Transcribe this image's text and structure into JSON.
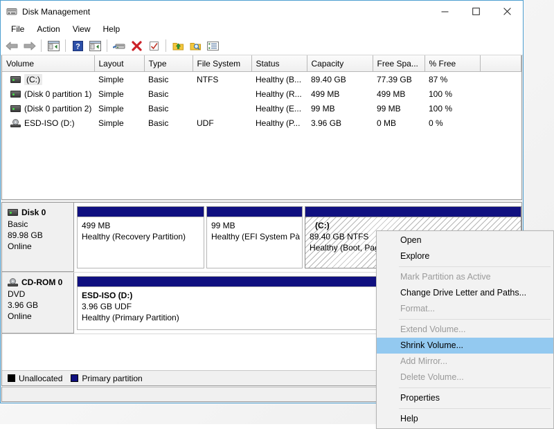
{
  "window": {
    "title": "Disk Management",
    "app_icon": "disk-management-icon",
    "caption": {
      "minimize": "minimize-icon",
      "maximize": "maximize-icon",
      "close": "close-icon"
    }
  },
  "menubar": {
    "items": [
      {
        "label": "File"
      },
      {
        "label": "Action"
      },
      {
        "label": "View"
      },
      {
        "label": "Help"
      }
    ]
  },
  "toolbar": {
    "buttons": [
      {
        "name": "back-arrow-icon",
        "title": "Back"
      },
      {
        "name": "forward-arrow-icon",
        "title": "Forward"
      },
      {
        "name": "up-one-level-icon",
        "title": "Up one level"
      },
      {
        "name": "help-icon",
        "title": "Help"
      },
      {
        "name": "show-console-tree-icon",
        "title": "Show/Hide Console Tree"
      },
      {
        "name": "properties-disk-icon",
        "title": "Properties"
      },
      {
        "name": "delete-icon",
        "title": "Delete"
      },
      {
        "name": "refresh-check-icon",
        "title": "Refresh"
      },
      {
        "name": "export-list-icon",
        "title": "Export List"
      },
      {
        "name": "search-folder-icon",
        "title": "Find"
      },
      {
        "name": "detail-list-icon",
        "title": "Show Details"
      }
    ]
  },
  "volume_list": {
    "columns": [
      "Volume",
      "Layout",
      "Type",
      "File System",
      "Status",
      "Capacity",
      "Free Spa...",
      "% Free"
    ],
    "rows": [
      {
        "icon": "hard-disk-icon",
        "volume": "(C:)",
        "layout": "Simple",
        "type": "Basic",
        "file_system": "NTFS",
        "status": "Healthy (B...",
        "capacity": "89.40 GB",
        "free_space": "77.39 GB",
        "percent_free": "87 %",
        "selected": true
      },
      {
        "icon": "hard-disk-icon",
        "volume": "(Disk 0 partition 1)",
        "layout": "Simple",
        "type": "Basic",
        "file_system": "",
        "status": "Healthy (R...",
        "capacity": "499 MB",
        "free_space": "499 MB",
        "percent_free": "100 %",
        "selected": false
      },
      {
        "icon": "hard-disk-icon",
        "volume": "(Disk 0 partition 2)",
        "layout": "Simple",
        "type": "Basic",
        "file_system": "",
        "status": "Healthy (E...",
        "capacity": "99 MB",
        "free_space": "99 MB",
        "percent_free": "100 %",
        "selected": false
      },
      {
        "icon": "cd-rom-icon",
        "volume": "ESD-ISO (D:)",
        "layout": "Simple",
        "type": "Basic",
        "file_system": "UDF",
        "status": "Healthy (P...",
        "capacity": "3.96 GB",
        "free_space": "0 MB",
        "percent_free": "0 %",
        "selected": false
      }
    ]
  },
  "graphic_view": {
    "disks": [
      {
        "icon": "hard-disk-icon",
        "name": "Disk 0",
        "type": "Basic",
        "size": "89.98 GB",
        "state": "Online",
        "partitions": [
          {
            "name": "",
            "size_fs": "499 MB",
            "status": "Healthy (Recovery Partition)",
            "selected": false,
            "width_pct": 42
          },
          {
            "name": "",
            "size_fs": "99 MB",
            "status": "Healthy (EFI System Pà",
            "selected": false,
            "width_pct": 29
          },
          {
            "name": "(C:)",
            "size_fs": "89.40 GB NTFS",
            "status": "Healthy (Boot, Page Fi",
            "selected": true,
            "width_pct": 29
          }
        ]
      },
      {
        "icon": "cd-rom-icon",
        "name": "CD-ROM 0",
        "type": "DVD",
        "size": "3.96 GB",
        "state": "Online",
        "partitions": [
          {
            "name": "ESD-ISO  (D:)",
            "size_fs": "3.96 GB UDF",
            "status": "Healthy (Primary Partition)",
            "selected": false,
            "width_pct": 100
          }
        ]
      }
    ]
  },
  "legend": {
    "entries": [
      {
        "label": "Unallocated",
        "color": "#000000"
      },
      {
        "label": "Primary partition",
        "color": "#101080"
      }
    ]
  },
  "context_menu": {
    "items": [
      {
        "label": "Open",
        "state": "enabled"
      },
      {
        "label": "Explore",
        "state": "enabled"
      },
      {
        "label": "",
        "state": "separator"
      },
      {
        "label": "Mark Partition as Active",
        "state": "disabled"
      },
      {
        "label": "Change Drive Letter and Paths...",
        "state": "enabled"
      },
      {
        "label": "Format...",
        "state": "disabled"
      },
      {
        "label": "",
        "state": "separator"
      },
      {
        "label": "Extend Volume...",
        "state": "disabled"
      },
      {
        "label": "Shrink Volume...",
        "state": "highlight"
      },
      {
        "label": "Add Mirror...",
        "state": "disabled"
      },
      {
        "label": "Delete Volume...",
        "state": "disabled"
      },
      {
        "label": "",
        "state": "separator"
      },
      {
        "label": "Properties",
        "state": "enabled"
      },
      {
        "label": "",
        "state": "separator"
      },
      {
        "label": "Help",
        "state": "enabled"
      }
    ]
  },
  "colors": {
    "window_border": "#4c9ed0",
    "partition_band": "#101080",
    "menu_highlight": "#93c9f0",
    "unallocated": "#000000"
  }
}
